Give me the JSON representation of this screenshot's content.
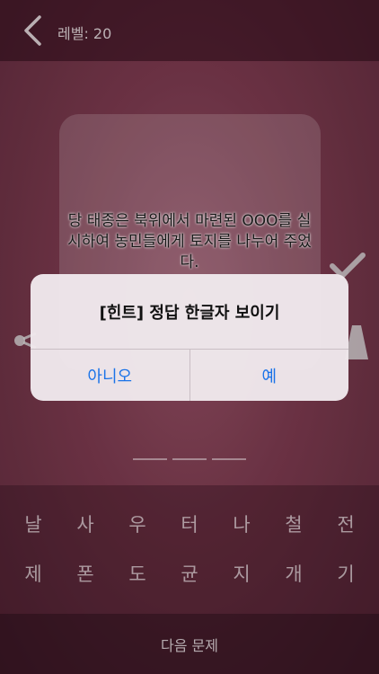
{
  "header": {
    "level_label": "레벨: 20"
  },
  "question": {
    "text": "당 태종은 북위에서 마련된 OOO를 실시하여 농민들에게 토지를 나누어 주었다."
  },
  "answer": {
    "blank_count": 3
  },
  "keyboard": {
    "row1": [
      "날",
      "사",
      "우",
      "터",
      "나",
      "철",
      "전"
    ],
    "row2": [
      "제",
      "폰",
      "도",
      "균",
      "지",
      "개",
      "기"
    ]
  },
  "footer": {
    "next_label": "다음 문제"
  },
  "alert": {
    "title": "[힌트] 정답 한글자 보이기",
    "cancel_label": "아니오",
    "confirm_label": "예"
  },
  "colors": {
    "accent": "#1a73e8",
    "background": "#733649"
  },
  "icons": [
    "chevron-left-icon",
    "check-icon",
    "trophy-icon",
    "share-icon"
  ]
}
